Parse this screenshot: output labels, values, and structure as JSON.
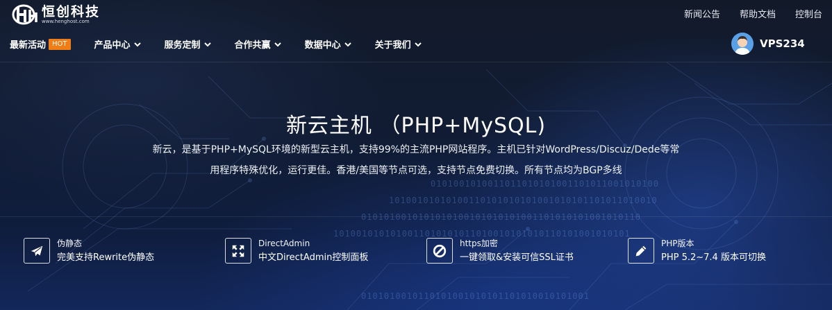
{
  "brand": {
    "name": "恒创科技",
    "domain": "www.henghost.com",
    "logo_icon": "hc-logo-icon"
  },
  "top_links": [
    "新闻公告",
    "帮助文档",
    "控制台"
  ],
  "nav": {
    "items": [
      {
        "label": "最新活动",
        "badge": "HOT",
        "has_dropdown": false
      },
      {
        "label": "产品中心",
        "has_dropdown": true
      },
      {
        "label": "服务定制",
        "has_dropdown": true
      },
      {
        "label": "合作共赢",
        "has_dropdown": true
      },
      {
        "label": "数据中心",
        "has_dropdown": true
      },
      {
        "label": "关于我们",
        "has_dropdown": true
      }
    ]
  },
  "user": {
    "name": "VPS234",
    "avatar_icon": "avatar-icon"
  },
  "hero": {
    "title": "新云主机 （PHP+MySQL)",
    "description": "新云，是基于PHP+MySQL环境的新型云主机，支持99%的主流PHP网站程序。主机已针对WordPress/Discuz/Dede等常用程序特殊优化，运行更佳。香港/美国等节点可选，支持节点免费切换。所有节点均为BGP多线"
  },
  "features": [
    {
      "icon": "airplane-icon",
      "title": "伪静态",
      "subtitle": "完美支持Rewrite伪静态"
    },
    {
      "icon": "expand-arrows-icon",
      "title": "DirectAdmin",
      "subtitle": "中文DirectAdmin控制面板"
    },
    {
      "icon": "ban-icon",
      "title": "https加密",
      "subtitle": "一键领取&安装可信SSL证书"
    },
    {
      "icon": "pencil-icon",
      "title": "PHP版本",
      "subtitle": "PHP 5.2~7.4 版本可切换"
    }
  ],
  "colors": {
    "hot_badge": "#f07d16",
    "avatar_bg": "#5aa0e6",
    "background": "#0c1424"
  }
}
